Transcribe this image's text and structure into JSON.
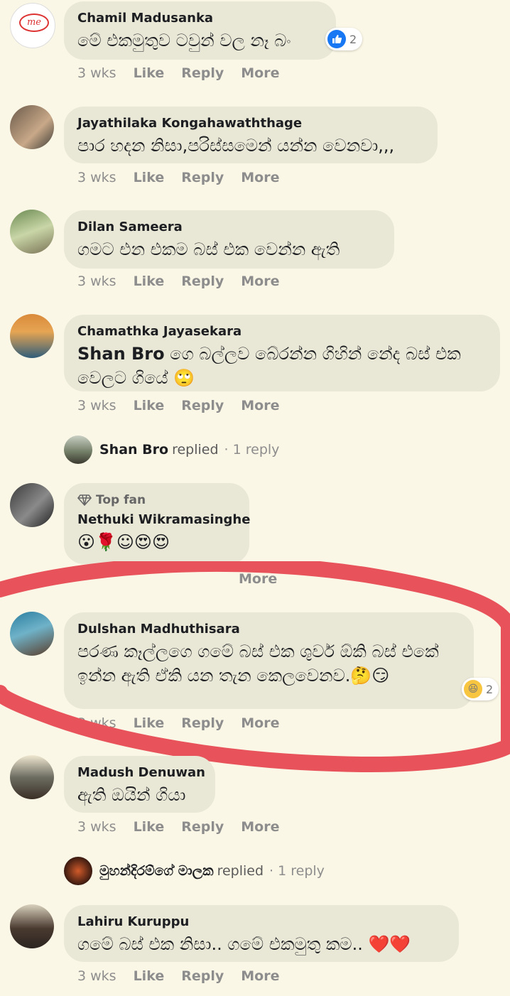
{
  "comments": [
    {
      "name": "Chamil Madusanka",
      "text": "මේ එකමුතුව ටවුන් වල නෑ බං",
      "time": "3 wks",
      "reactions": "2",
      "avatar_text": "me"
    },
    {
      "name": "Jayathilaka Kongahawaththage",
      "text": "පාර හදන නිසා,පරිස්සමෙන් යන්න වෙනවා,,,",
      "time": "3 wks"
    },
    {
      "name": "Dilan Sameera",
      "text": "ගමට එන එකම බස් එක වෙන්න ඇති",
      "time": "3 wks"
    },
    {
      "name": "Chamathka Jayasekara",
      "mention": "Shan Bro",
      "text_after": " ගෙ බල්ලව බේරන්න ගිහින් නේද බස් එක වෙලට ගියේ 🙄",
      "time": "3 wks"
    },
    {
      "badge": "Top fan",
      "name": "Nethuki Wikramasinghe",
      "text": "😮🌹☺😍😍",
      "time": "3 wks"
    },
    {
      "name": "Dulshan Madhuthisara",
      "text": "පරණ කෑල්ලගෙ ගමේ බස් එක ශුවර් ඕකි බස් එකේ ඉන්න ඇති ඒකි යන තැන කෙලවෙනව.🤔😏",
      "time": "3 wks",
      "reactions": "2"
    },
    {
      "name": "Madush Denuwan",
      "text": "ඇති ඔයින් ගියා",
      "time": "3 wks"
    },
    {
      "name": "Lahiru Kuruppu",
      "text": "ගමේ බස් එක නිසා.. ගමේ එකමුතු කම.. ❤️❤️",
      "time": "3 wks"
    }
  ],
  "replies": [
    {
      "name": "Shan Bro",
      "verb": "replied",
      "count": "· 1 reply"
    },
    {
      "name": "මුහන්දිරම්ගේ මාලක",
      "verb": "replied",
      "count": "· 1 reply"
    }
  ],
  "labels": {
    "like": "Like",
    "reply": "Reply",
    "more": "More"
  },
  "colors": {
    "background": "#fbf7e6",
    "bubble": "#e9e7d6",
    "annotation": "#e8525a",
    "like_blue": "#1877f2"
  }
}
